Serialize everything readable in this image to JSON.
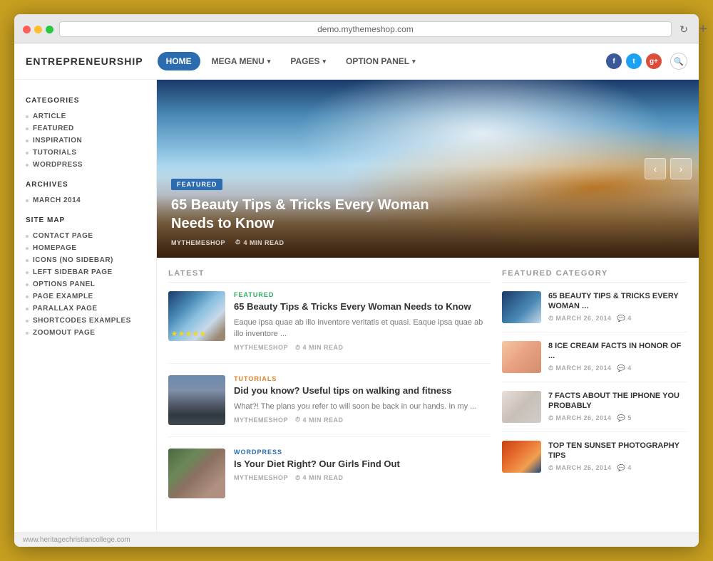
{
  "browser": {
    "url": "demo.mythemeshop.com",
    "new_tab_label": "+",
    "status_url": "www.heritagechristiancollege.com"
  },
  "site": {
    "logo": "ENTREPRENEURSHIP",
    "nav": {
      "items": [
        {
          "label": "HOME",
          "active": true
        },
        {
          "label": "MEGA MENU",
          "has_arrow": true
        },
        {
          "label": "PAGES",
          "has_arrow": true
        },
        {
          "label": "OPTION PANEL",
          "has_arrow": true
        }
      ]
    },
    "social": {
      "facebook_label": "f",
      "twitter_label": "t",
      "gplus_label": "g+"
    }
  },
  "sidebar": {
    "categories_label": "CATEGORIES",
    "categories": [
      {
        "label": "ARTICLE"
      },
      {
        "label": "FEATURED"
      },
      {
        "label": "INSPIRATION"
      },
      {
        "label": "TUTORIALS"
      },
      {
        "label": "WORDPRESS"
      }
    ],
    "archives_label": "ARCHIVES",
    "archives": [
      {
        "label": "MARCH 2014"
      }
    ],
    "sitemap_label": "SITE MAP",
    "sitemap": [
      {
        "label": "CONTACT PAGE"
      },
      {
        "label": "HOMEPAGE"
      },
      {
        "label": "ICONS (NO SIDEBAR)"
      },
      {
        "label": "LEFT SIDEBAR PAGE"
      },
      {
        "label": "OPTIONS PANEL"
      },
      {
        "label": "PAGE EXAMPLE"
      },
      {
        "label": "PARALLAX PAGE"
      },
      {
        "label": "SHORTCODES EXAMPLES"
      },
      {
        "label": "ZOOMOUT PAGE"
      }
    ]
  },
  "hero": {
    "badge": "FEATURED",
    "title": "65 Beauty Tips & Tricks Every Woman Needs to Know",
    "author": "MYTHEMESHOP",
    "read_time": "4 MIN READ",
    "prev_label": "‹",
    "next_label": "›"
  },
  "latest": {
    "section_label": "LATEST",
    "posts": [
      {
        "category": "FEATURED",
        "category_class": "cat-featured",
        "title": "65 Beauty Tips & Tricks Every Woman Needs to Know",
        "excerpt": "Eaque ipsa quae ab illo inventore veritatis et quasi. Eaque ipsa quae ab illo inventore ...",
        "author": "MYTHEMESHOP",
        "read_time": "4 MIN READ",
        "thumb_class": "post-thumb-mountain",
        "has_stars": true
      },
      {
        "category": "TUTORIALS",
        "category_class": "cat-tutorials",
        "title": "Did you know? Useful tips on walking and fitness",
        "excerpt": "What?! The plans you refer to will soon be back in our hands. In my ...",
        "author": "MYTHEMESHOP",
        "read_time": "4 MIN READ",
        "thumb_class": "post-thumb-city",
        "has_stars": false
      },
      {
        "category": "WORDPRESS",
        "category_class": "cat-wordpress",
        "title": "Is Your Diet Right? Our Girls Find Out",
        "excerpt": "",
        "author": "MYTHEMESHOP",
        "read_time": "4 MIN READ",
        "thumb_class": "post-thumb-girl",
        "has_stars": false
      }
    ]
  },
  "featured_category": {
    "section_label": "FEATURED CATEGORY",
    "items": [
      {
        "title": "65 BEAUTY TIPS & TRICKS EVERY WOMAN ...",
        "date": "MARCH 26, 2014",
        "comments": "4",
        "thumb_class": "fc-thumb-sky"
      },
      {
        "title": "8 ICE CREAM FACTS IN HONOR OF ...",
        "date": "MARCH 26, 2014",
        "comments": "4",
        "thumb_class": "fc-thumb-icecream"
      },
      {
        "title": "7 FACTS ABOUT THE IPHONE YOU PROBABLY",
        "date": "MARCH 26, 2014",
        "comments": "5",
        "thumb_class": "fc-thumb-phone"
      },
      {
        "title": "TOP TEN SUNSET PHOTOGRAPHY TIPS",
        "date": "MARCH 26, 2014",
        "comments": "4",
        "thumb_class": "fc-thumb-sunset"
      }
    ]
  }
}
